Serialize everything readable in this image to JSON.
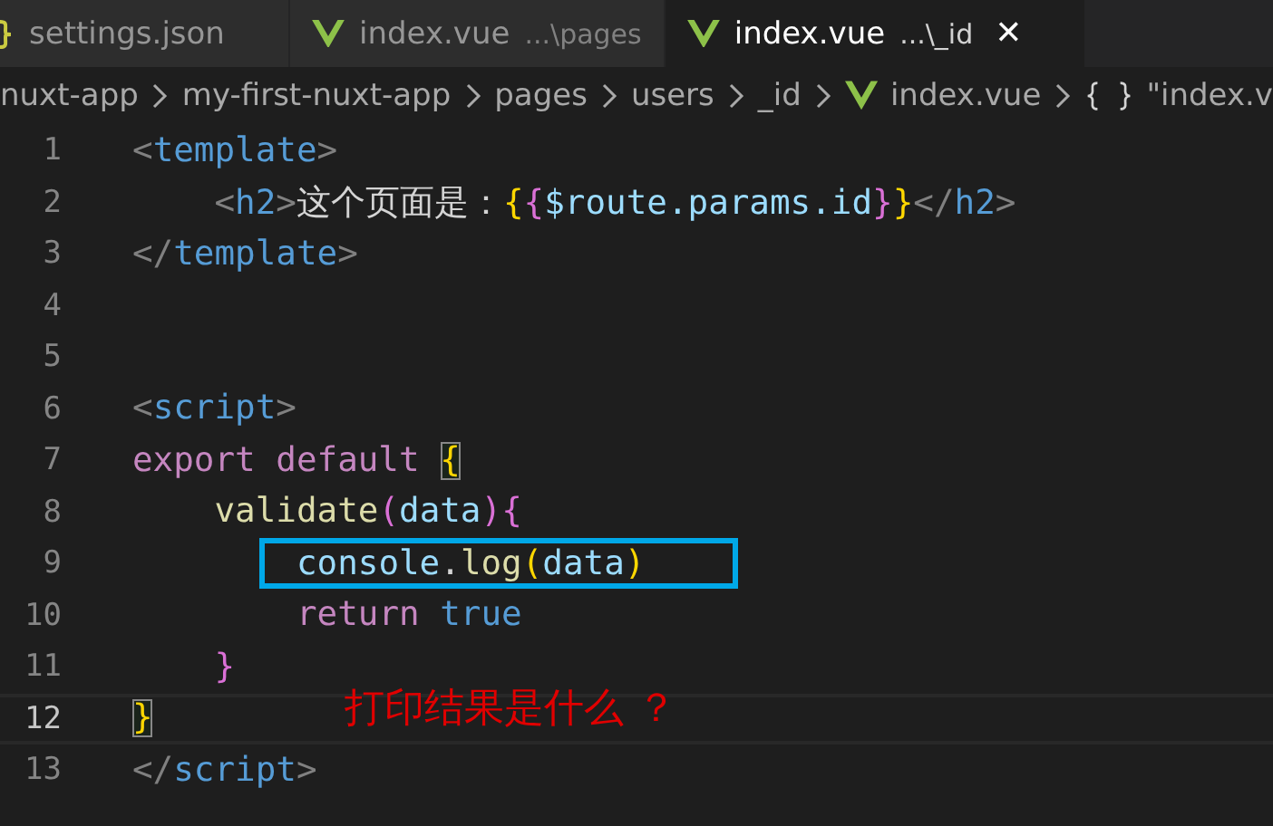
{
  "tabs": [
    {
      "name": "settings.json",
      "kind": "json",
      "selected": false
    },
    {
      "name": "index.vue",
      "kind": "vue",
      "path": "...\\pages",
      "selected": false
    },
    {
      "name": "index.vue",
      "kind": "vue",
      "path": "...\\_id",
      "selected": true,
      "close": "✕"
    }
  ],
  "breadcrumb": [
    {
      "label": "nuxt-app",
      "kind": "folder"
    },
    {
      "label": "my-first-nuxt-app",
      "kind": "folder"
    },
    {
      "label": "pages",
      "kind": "folder"
    },
    {
      "label": "users",
      "kind": "folder"
    },
    {
      "label": "_id",
      "kind": "folder"
    },
    {
      "label": "index.vue",
      "kind": "vue"
    },
    {
      "label": "\"index.v",
      "kind": "symbol"
    }
  ],
  "editor": {
    "lines": [
      {
        "number": "1",
        "current": false,
        "tokens": [
          {
            "text": "<",
            "kind": "punct"
          },
          {
            "text": "template",
            "kind": "tag"
          },
          {
            "text": ">",
            "kind": "punct"
          }
        ]
      },
      {
        "number": "2",
        "current": false,
        "tokens": [
          {
            "text": "    <",
            "kind": "punct"
          },
          {
            "text": "h2",
            "kind": "tag"
          },
          {
            "text": ">",
            "kind": "punct"
          },
          {
            "text": "这个页面是：",
            "kind": "plain"
          },
          {
            "text": "{",
            "kind": "gold"
          },
          {
            "text": "{",
            "kind": "pink"
          },
          {
            "text": "$route.params.id",
            "kind": "variable"
          },
          {
            "text": "}",
            "kind": "pink"
          },
          {
            "text": "}",
            "kind": "gold"
          },
          {
            "text": "</",
            "kind": "punct"
          },
          {
            "text": "h2",
            "kind": "tag"
          },
          {
            "text": ">",
            "kind": "punct"
          }
        ]
      },
      {
        "number": "3",
        "current": false,
        "tokens": [
          {
            "text": "</",
            "kind": "punct"
          },
          {
            "text": "template",
            "kind": "tag"
          },
          {
            "text": ">",
            "kind": "punct"
          }
        ]
      },
      {
        "number": "4",
        "current": false
      },
      {
        "number": "5",
        "current": false
      },
      {
        "number": "6",
        "current": false,
        "tokens": [
          {
            "text": "<",
            "kind": "punct"
          },
          {
            "text": "script",
            "kind": "tag"
          },
          {
            "text": ">",
            "kind": "punct"
          }
        ]
      },
      {
        "number": "7",
        "current": false,
        "tokens": [
          {
            "text": "export default ",
            "kind": "keyword"
          },
          {
            "text": "{",
            "kind": "gold",
            "matched": true
          }
        ]
      },
      {
        "number": "8",
        "current": false,
        "tokens": [
          {
            "text": "    validate",
            "kind": "function"
          },
          {
            "text": "(",
            "kind": "pink"
          },
          {
            "text": "data",
            "kind": "variable"
          },
          {
            "text": ")",
            "kind": "pink"
          },
          {
            "text": "{",
            "kind": "pink"
          }
        ]
      },
      {
        "number": "9",
        "current": false,
        "framed": true,
        "tokens": [
          {
            "text": "        console",
            "kind": "variable"
          },
          {
            "text": ".",
            "kind": "plain"
          },
          {
            "text": "log",
            "kind": "function"
          },
          {
            "text": "(",
            "kind": "gold"
          },
          {
            "text": "data",
            "kind": "variable"
          },
          {
            "text": ")",
            "kind": "gold"
          }
        ]
      },
      {
        "number": "10",
        "current": false,
        "tokens": [
          {
            "text": "        return ",
            "kind": "keyword"
          },
          {
            "text": "true",
            "kind": "tag"
          }
        ]
      },
      {
        "number": "11",
        "current": false,
        "tokens": [
          {
            "text": "    }",
            "kind": "pink"
          }
        ]
      },
      {
        "number": "12",
        "current": true,
        "tokens": [
          {
            "text": "}",
            "kind": "gold",
            "matched": true
          }
        ]
      },
      {
        "number": "13",
        "current": false,
        "tokens": [
          {
            "text": "</",
            "kind": "punct"
          },
          {
            "text": "script",
            "kind": "tag"
          },
          {
            "text": ">",
            "kind": "punct"
          }
        ]
      }
    ],
    "annotation": "打印结果是什么 ？"
  }
}
